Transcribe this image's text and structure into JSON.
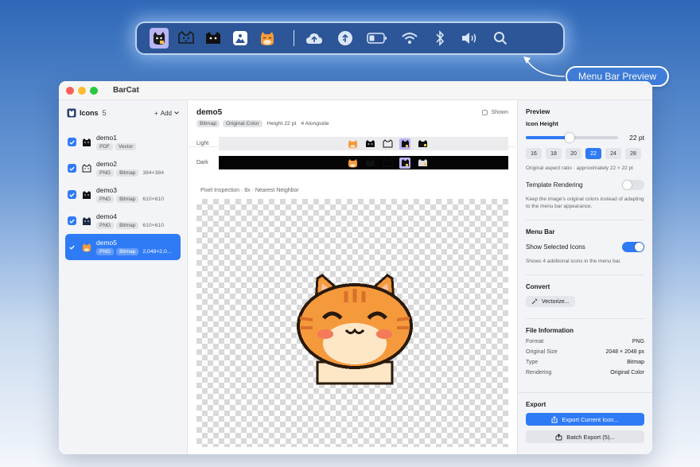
{
  "menubar_preview": {
    "icons": [
      {
        "name": "cat-selected-icon",
        "selected": true
      },
      {
        "name": "cat-outline-icon",
        "selected": false
      },
      {
        "name": "cat-black-icon",
        "selected": false
      },
      {
        "name": "image-icon",
        "selected": false
      },
      {
        "name": "orange-cat-icon",
        "selected": false
      }
    ],
    "system_icons": [
      "cloud-upload-icon",
      "tree-upload-icon",
      "battery-icon",
      "wifi-icon",
      "bluetooth-icon",
      "volume-icon",
      "search-icon",
      "control-center-icon"
    ],
    "callout": "Menu Bar Preview"
  },
  "window": {
    "title": "BarCat"
  },
  "sidebar": {
    "title": "Icons",
    "count": "5",
    "add_label": "Add",
    "items": [
      {
        "name": "demo1",
        "tags": [
          "PDF",
          "Vector"
        ],
        "dims": ""
      },
      {
        "name": "demo2",
        "tags": [
          "PNG",
          "Bitmap"
        ],
        "dims": "384×384"
      },
      {
        "name": "demo3",
        "tags": [
          "PNG",
          "Bitmap"
        ],
        "dims": "610×610"
      },
      {
        "name": "demo4",
        "tags": [
          "PNG",
          "Bitmap"
        ],
        "dims": "610×610"
      },
      {
        "name": "demo5",
        "tags": [
          "PNG",
          "Bitmap"
        ],
        "dims": "2,048×2,0..."
      }
    ]
  },
  "detail": {
    "name": "demo5",
    "tags": [
      "Bitmap",
      "Original Color"
    ],
    "height_text": "Height 22 pt",
    "alongside_text": "4 Alongside",
    "shown_label": "Shown",
    "light_label": "Light",
    "dark_label": "Dark",
    "pixel_header": "Pixel Inspection · 8x · Nearest Neighbor"
  },
  "panel": {
    "preview_title": "Preview",
    "icon_height_label": "Icon Height",
    "icon_height_value": "22 pt",
    "slider_fraction": 0.47,
    "sizes": [
      "16",
      "18",
      "20",
      "22",
      "24",
      "28"
    ],
    "selected_size": "22",
    "aspect_note": "Original aspect ratio · approximately 22 × 22 pt",
    "template_label": "Template Rendering",
    "template_on": false,
    "template_note": "Keep the image's original colors instead of adapting to the menu bar appearance.",
    "menubar_title": "Menu Bar",
    "show_selected_label": "Show Selected Icons",
    "show_selected_on": true,
    "show_selected_note": "Shows 4 additional icons in the menu bar.",
    "convert_title": "Convert",
    "vectorize_label": "Vectorize...",
    "file_info_title": "File Information",
    "file_info": [
      {
        "label": "Format",
        "value": "PNG"
      },
      {
        "label": "Original Size",
        "value": "2048 × 2048 px"
      },
      {
        "label": "Type",
        "value": "Bitmap"
      },
      {
        "label": "Rendering",
        "value": "Original Color"
      }
    ],
    "export_title": "Export",
    "export_current_label": "Export Current Icon...",
    "batch_export_label": "Batch Export (5)..."
  },
  "colors": {
    "accent": "#2f7bf6",
    "menubar_bg": "#2c5698",
    "selection_purple": "#b9b4f2",
    "cat_orange": "#f59a3c"
  }
}
